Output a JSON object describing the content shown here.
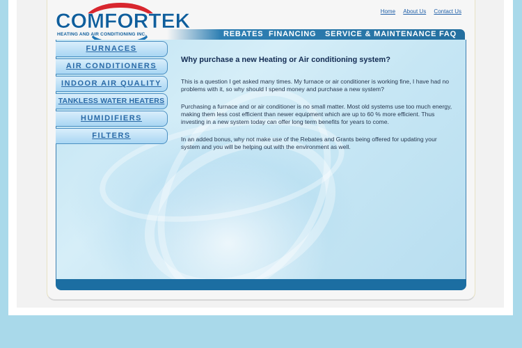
{
  "logo": {
    "name": "COMFORTEK",
    "tagline": "HEATING AND AIR CONDITIONING INC."
  },
  "top_links": [
    "Home",
    "About Us",
    "Contact Us"
  ],
  "nav": [
    "REBATES",
    "FINANCING",
    "SERVICE & MAINTENANCE",
    "FAQ"
  ],
  "sidebar": [
    "FURNACES",
    "AIR CONDITIONERS",
    "INDOOR AIR QUALITY",
    "TANKLESS WATER HEATERS",
    "HUMIDIFIERS",
    "FILTERS"
  ],
  "article": {
    "title": "Why purchase a new Heating or Air conditioning system?",
    "paragraphs": [
      "This is a question I get asked many times. My furnace or air conditioner is working fine, I have had no problems with it, so why should I spend money and purchase a new system?",
      "Purchasing a furnace and or air conditioner is no small matter. Most old systems use too much energy, making them less cost efficient than newer equipment which are up to 60 % more efficient. Thus investing in a new system today can offer long term benefits for years to come.",
      "In an added bonus, why not make use of the Rebates and Grants being offered for updating your system and you will be helping out with the environment as well."
    ]
  },
  "colors": {
    "page_background": "#a9d9ea",
    "brand_blue": "#0f5e9c",
    "logo_red": "#d8262e",
    "nav_bar": "#246f9f",
    "link": "#1f5fa8"
  }
}
